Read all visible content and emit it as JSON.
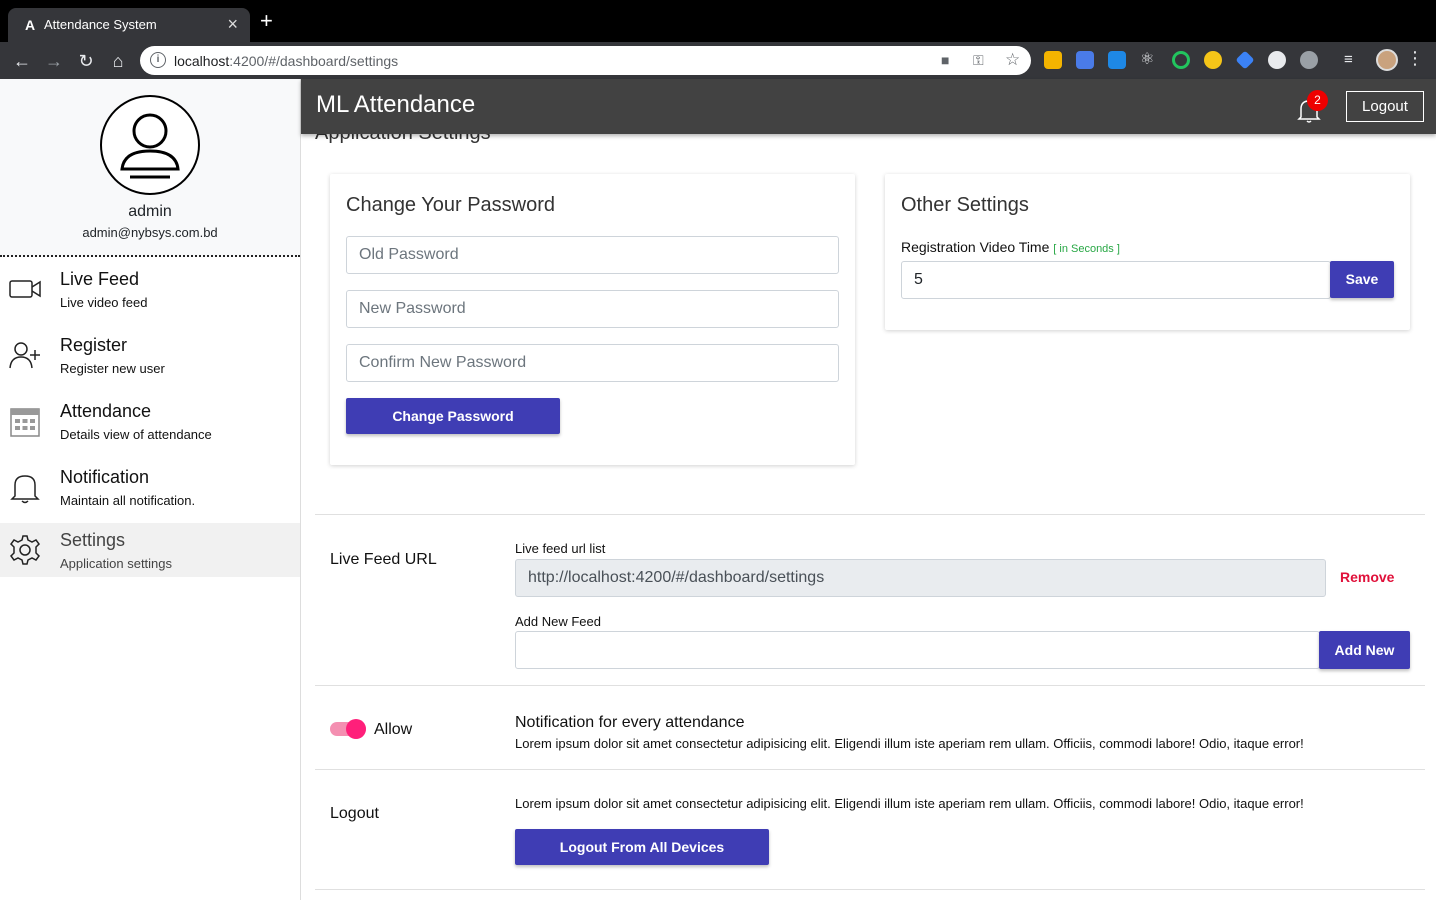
{
  "browser": {
    "tab_title": "Attendance System",
    "tab_close": "×",
    "new_tab": "+",
    "url_host": "localhost",
    "url_path": ":4200/#/dashboard/settings",
    "tab_favicon": "A"
  },
  "app": {
    "brand": "ML Attendance",
    "notification_count": "2",
    "logout_label": "Logout"
  },
  "profile": {
    "name": "admin",
    "email": "admin@nybsys.com.bd"
  },
  "menu": [
    {
      "title": "Live Feed",
      "subtitle": "Live video feed",
      "icon": "video-camera-icon"
    },
    {
      "title": "Register",
      "subtitle": "Register new user",
      "icon": "add-user-icon"
    },
    {
      "title": "Attendance",
      "subtitle": "Details view of attendance",
      "icon": "calendar-icon"
    },
    {
      "title": "Notification",
      "subtitle": "Maintain all notification.",
      "icon": "bell-icon"
    },
    {
      "title": "Settings",
      "subtitle": "Application settings",
      "icon": "gear-icon"
    }
  ],
  "settings": {
    "page_heading": "Application Settings",
    "password_card": {
      "title": "Change Your Password",
      "old_placeholder": "Old Password",
      "new_placeholder": "New Password",
      "confirm_placeholder": "Confirm New Password",
      "button": "Change Password"
    },
    "other_card": {
      "title": "Other Settings",
      "video_time_label": "Registration Video Time",
      "video_time_hint": "[ in Seconds ]",
      "video_time_value": "5",
      "save_button": "Save"
    },
    "live_feed": {
      "section_label": "Live Feed URL",
      "list_label": "Live feed url list",
      "urls": [
        "http://localhost:4200/#/dashboard/settings"
      ],
      "remove_label": "Remove",
      "add_label": "Add New Feed",
      "add_value": "",
      "add_button": "Add New"
    },
    "notification": {
      "toggle_label": "Allow",
      "toggle_on": true,
      "title": "Notification for every attendance",
      "description": "Lorem ipsum dolor sit amet consectetur adipisicing elit. Eligendi illum iste aperiam rem ullam. Officiis, commodi labore! Odio, itaque error!"
    },
    "logout": {
      "section_label": "Logout",
      "description": "Lorem ipsum dolor sit amet consectetur adipisicing elit. Eligendi illum iste aperiam rem ullam. Officiis, commodi labore! Odio, itaque error!",
      "button": "Logout From All Devices"
    }
  },
  "colors": {
    "primary_button": "#3f3db4",
    "remove_text": "#e0103a",
    "hint_green": "#28a745",
    "toggle_pink": "#ff1f7a",
    "appbar": "#424242"
  }
}
